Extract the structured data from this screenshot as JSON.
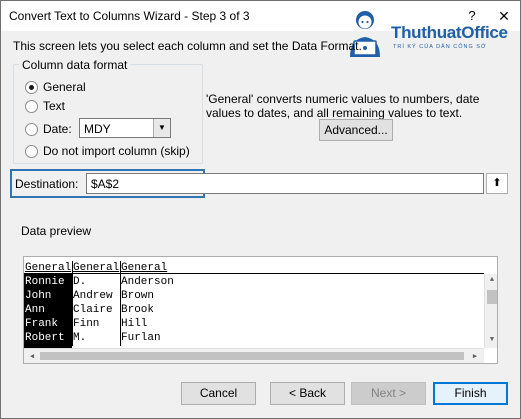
{
  "window": {
    "title": "Convert Text to Columns Wizard - Step 3 of 3",
    "help_label": "?",
    "close_label": "✕"
  },
  "watermark": {
    "name": "ThuthuatOffice",
    "tagline": "TRÍ KÝ CỦA DÂN CÔNG SỞ"
  },
  "intro": "This screen lets you select each column and set the Data Format.",
  "column_format": {
    "legend": "Column data format",
    "options": [
      {
        "label": "General",
        "selected": true
      },
      {
        "label": "Text",
        "selected": false
      },
      {
        "label": "Date:",
        "selected": false
      },
      {
        "label": "Do not import column (skip)",
        "selected": false
      }
    ],
    "date_value": "MDY"
  },
  "hint": "'General' converts numeric values to numbers, date values to dates, and all remaining values to text.",
  "advanced_label": "Advanced...",
  "destination": {
    "label": "Destination:",
    "value": "$A$2",
    "picker_icon": "range-select-icon"
  },
  "preview": {
    "label": "Data preview",
    "headers": [
      "General",
      "General",
      "General"
    ],
    "rows": [
      [
        "Ronnie",
        "D.",
        "Anderson"
      ],
      [
        "John",
        "Andrew",
        "Brown"
      ],
      [
        "Ann",
        "Claire",
        "Brook"
      ],
      [
        "Frank",
        "Finn",
        "Hill"
      ],
      [
        "Robert",
        "M.",
        "Furlan"
      ]
    ]
  },
  "buttons": {
    "cancel": "Cancel",
    "back": "< Back",
    "next": "Next >",
    "finish": "Finish"
  },
  "colors": {
    "highlight_border": "#2e75b6",
    "default_button_border": "#0078d7",
    "logo_blue": "#1f5fa8"
  }
}
